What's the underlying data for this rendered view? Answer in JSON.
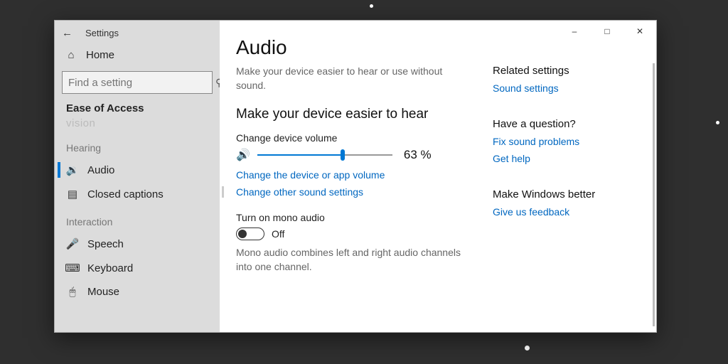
{
  "titlebar": {
    "title": "Settings"
  },
  "sidebar": {
    "home": "Home",
    "search_placeholder": "Find a setting",
    "category": "Ease of Access",
    "vision_cut": "vision",
    "groups": {
      "hearing": "Hearing",
      "interaction": "Interaction"
    },
    "items": {
      "audio": "Audio",
      "closed_captions": "Closed captions",
      "speech": "Speech",
      "keyboard": "Keyboard",
      "mouse": "Mouse"
    }
  },
  "page": {
    "title": "Audio",
    "subtitle": "Make your device easier to hear or use without sound.",
    "section1_heading": "Make your device easier to hear",
    "volume_label": "Change device volume",
    "volume_percent": 63,
    "volume_display": "63 %",
    "link_device_app_volume": "Change the device or app volume",
    "link_other_sound": "Change other sound settings",
    "mono_label": "Turn on mono audio",
    "mono_state": "Off",
    "mono_desc": "Mono audio combines left and right audio channels into one channel."
  },
  "right": {
    "related_heading": "Related settings",
    "sound_settings": "Sound settings",
    "question_heading": "Have a question?",
    "fix_sound": "Fix sound problems",
    "get_help": "Get help",
    "better_heading": "Make Windows better",
    "feedback": "Give us feedback"
  }
}
